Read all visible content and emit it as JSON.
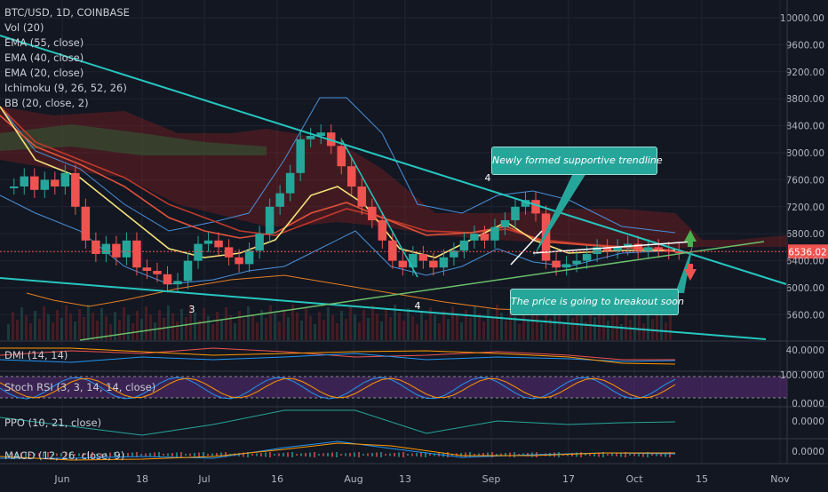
{
  "symbol_title": "BTC/USD, 1D, COINBASE",
  "indicators": [
    "Vol (20)",
    "EMA (55, close)",
    "EMA (40, close)",
    "EMA (20, close)",
    "Ichimoku (9, 26, 52, 26)",
    "BB (20, close, 2)"
  ],
  "panes": {
    "dmi": {
      "label": "DMI (14, 14)",
      "tick_label": "40.0000"
    },
    "stoch": {
      "label": "Stoch RSI (3, 3, 14, 14, close)",
      "top_label": "100.0000",
      "bottom_label": "0.0000"
    },
    "ppo": {
      "label": "PPO (10, 21, close)",
      "tick_label": "0.0000"
    },
    "macd": {
      "label": "MACD (12, 26, close, 9)",
      "tick_label": "0.0000"
    }
  },
  "annotations": {
    "trendline_note": "Newly formed supportive trendline",
    "breakout_note": "The price is going to breakout soon",
    "wave_labels": [
      "3",
      "4",
      "4"
    ]
  },
  "colors": {
    "background": "#131722",
    "up_candle": "#26a69a",
    "down_candle": "#ef5350",
    "trendline": "#26c6bf",
    "callout_bg": "#26a69a",
    "price_tag": "#ef5350",
    "ema20": "#f5e37a",
    "ema40": "#e0523a",
    "ema55": "#c0392b",
    "bb": "#4a90d9",
    "stoch_band": "#5b2d7a"
  },
  "chart_data": {
    "type": "candlestick",
    "title": "BTC/USD, 1D, COINBASE",
    "x_tick_labels": [
      "Jun",
      "18",
      "Jul",
      "16",
      "Aug",
      "13",
      "Sep",
      "17",
      "Oct",
      "15",
      "Nov"
    ],
    "y_tick_labels": [
      "10000.00",
      "9600.00",
      "9200.00",
      "8800.00",
      "8400.00",
      "8000.00",
      "7600.00",
      "7200.00",
      "6800.00",
      "6400.00",
      "6000.00",
      "5600.00"
    ],
    "ylim": [
      5350,
      10250
    ],
    "last_price": "6536.02",
    "price_series_estimated": [
      7500,
      7650,
      7450,
      7600,
      7500,
      7700,
      7200,
      6700,
      6500,
      6650,
      6450,
      6700,
      6300,
      6250,
      6200,
      6050,
      6100,
      6400,
      6650,
      6700,
      6600,
      6450,
      6350,
      6550,
      6800,
      7200,
      7400,
      7700,
      8200,
      8250,
      8300,
      8100,
      7800,
      7500,
      7200,
      7000,
      6700,
      6400,
      6300,
      6500,
      6400,
      6300,
      6450,
      6550,
      6700,
      6800,
      6700,
      6900,
      7000,
      7200,
      7300,
      7100,
      6400,
      6300,
      6350,
      6400,
      6500,
      6600,
      6550,
      6600,
      6650,
      6550,
      6600,
      6560,
      6540,
      6536
    ]
  }
}
